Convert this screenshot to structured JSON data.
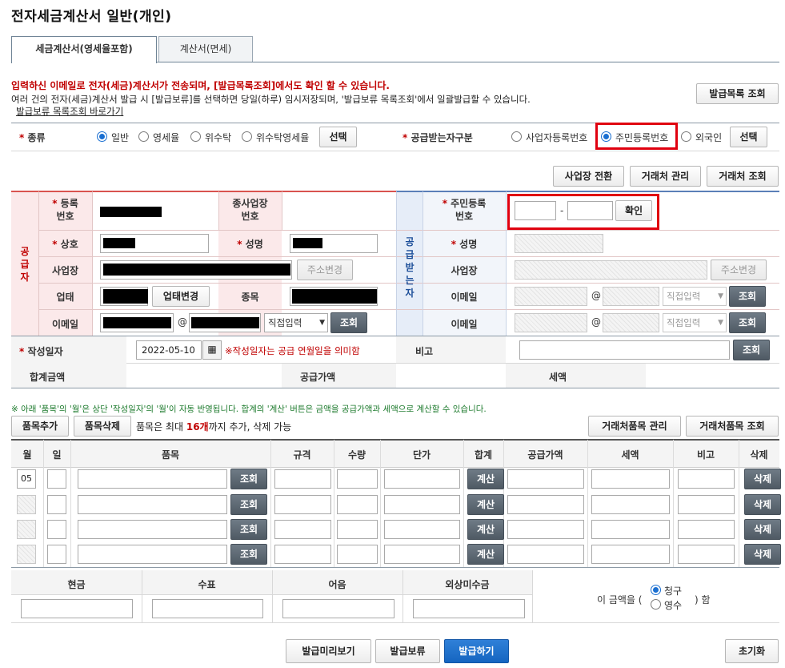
{
  "page_title": "전자세금계산서 일반(개인)",
  "tabs": [
    {
      "label": "세금계산서(영세율포함)"
    },
    {
      "label": "계산서(면세)"
    }
  ],
  "notice": {
    "line1": "입력하신 이메일로 전자(세금)계산서가 전송되며, [발급목록조회]에서도 확인 할 수 있습니다.",
    "line2": "여러 건의 전자(세금)계산서 발급 시 [발급보류]를 선택하면 당일(하루) 임시저장되며, '발급보류 목록조회'에서 일괄발급할 수 있습니다.",
    "link": "발급보류 목록조회 바로가기"
  },
  "issue_list_button": "발급목록 조회",
  "type_row": {
    "label": "종류",
    "options": [
      "일반",
      "영세율",
      "위수탁",
      "위수탁영세율"
    ],
    "selected": "일반",
    "select_button": "선택"
  },
  "receiver_type_row": {
    "label": "공급받는자구분",
    "options": [
      "사업자등록번호",
      "주민등록번호",
      "외국인"
    ],
    "selected": "주민등록번호",
    "select_button": "선택"
  },
  "action_buttons": {
    "workplace_switch": "사업장 전환",
    "client_manage": "거래처 관리",
    "client_search": "거래처 조회"
  },
  "supplier": {
    "section_label": "공급자",
    "reg_no_label": "등록\n번호",
    "sub_workplace_label": "종사업장\n번호",
    "company_label": "상호",
    "name_label": "성명",
    "address_label": "사업장",
    "address_change": "주소변경",
    "business_type_label": "업태",
    "business_change": "업태변경",
    "item_label": "종목",
    "email_label": "이메일",
    "email_at": "@",
    "email_domain_select": "직접입력",
    "search_button": "조회"
  },
  "receiver": {
    "section_label": "공급받는자",
    "rrn_label": "주민등록\n번호",
    "rrn_dash": "-",
    "confirm_button": "확인",
    "name_label": "성명",
    "address_label": "사업장",
    "address_change": "주소변경",
    "email_label": "이메일",
    "email_at": "@",
    "email_domain_select": "직접입력",
    "search_button": "조회"
  },
  "date_row": {
    "label": "작성일자",
    "value": "2022-05-10",
    "note": "※작성일자는 공급 연월일을 의미함",
    "remark_label": "비고",
    "remark_search": "조회"
  },
  "totals_row": {
    "total_label": "합계금액",
    "supply_label": "공급가액",
    "tax_label": "세액"
  },
  "items_notice": "※ 아래 '품목'의 '월'은 상단 '작성일자'의 '월'이 자동 반영됩니다. 합계의 '계산' 버튼은 금액을 공급가액과 세액으로 계산할 수 있습니다.",
  "items_toolbar": {
    "add": "품목추가",
    "delete": "품목삭제",
    "limit_prefix": "품목은 최대 ",
    "limit_count": "16개",
    "limit_suffix": "까지 추가, 삭제 가능",
    "client_item_manage": "거래처품목 관리",
    "client_item_search": "거래처품목 조회"
  },
  "items_table": {
    "headers": [
      "월",
      "일",
      "품목",
      "규격",
      "수량",
      "단가",
      "합계",
      "공급가액",
      "세액",
      "비고",
      "삭제"
    ],
    "first_month": "05",
    "search_button": "조회",
    "calc_button": "계산",
    "delete_button": "삭제"
  },
  "payment": {
    "headers": [
      "현금",
      "수표",
      "어음",
      "외상미수금"
    ],
    "amount_prefix": "이 금액을 (",
    "options": [
      "청구",
      "영수"
    ],
    "selected": "청구",
    "amount_suffix": ") 함"
  },
  "bottom_buttons": {
    "preview": "발급미리보기",
    "hold": "발급보류",
    "issue": "발급하기",
    "reset": "초기화"
  }
}
